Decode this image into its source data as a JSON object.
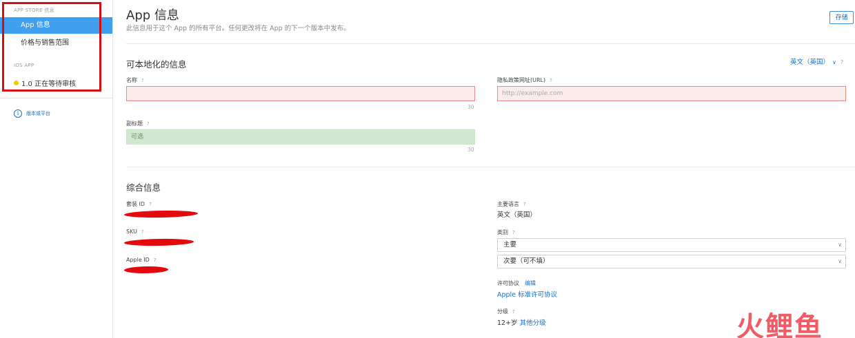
{
  "sidebar": {
    "section_app_store": "APP STORE 信息",
    "item_app_info": "App 信息",
    "item_pricing": "价格与销售范围",
    "section_ios": "iOS APP",
    "version_status": "1.0 正在等待审核",
    "version_platform": "版本或平台"
  },
  "header": {
    "title": "App 信息",
    "subtitle": "此信息用于这个 App 的所有平台。任何更改将在 App 的下一个版本中发布。",
    "save_label": "存储"
  },
  "localizable": {
    "title": "可本地化的信息",
    "language": "英文（英国）",
    "name_label": "名称",
    "name_counter": "30",
    "privacy_label": "隐私政策网址(URL)",
    "privacy_placeholder": "http://example.com",
    "subtitle_label": "副标题",
    "subtitle_placeholder": "可选",
    "subtitle_counter": "30"
  },
  "general": {
    "title": "综合信息",
    "bundle_id_label": "套装 ID",
    "sku_label": "SKU",
    "apple_id_label": "Apple ID",
    "primary_language_label": "主要语言",
    "primary_language_value": "英文（英国）",
    "category_label": "类别",
    "category_primary": "主要",
    "category_secondary": "次要（可不填）",
    "license_label": "许可协议",
    "license_edit": "编辑",
    "license_value": "Apple 标准许可协议",
    "rating_label": "分级",
    "rating_value": "12+岁",
    "rating_link": "其他分级"
  },
  "help_mark": "?",
  "watermark": "火鲤鱼",
  "colors": {
    "accent": "#3ea0ee",
    "link": "#1a6fc0",
    "error_bg": "#fbecec",
    "optional_bg": "#cfe8cf",
    "annotation_red": "#d50c10"
  }
}
